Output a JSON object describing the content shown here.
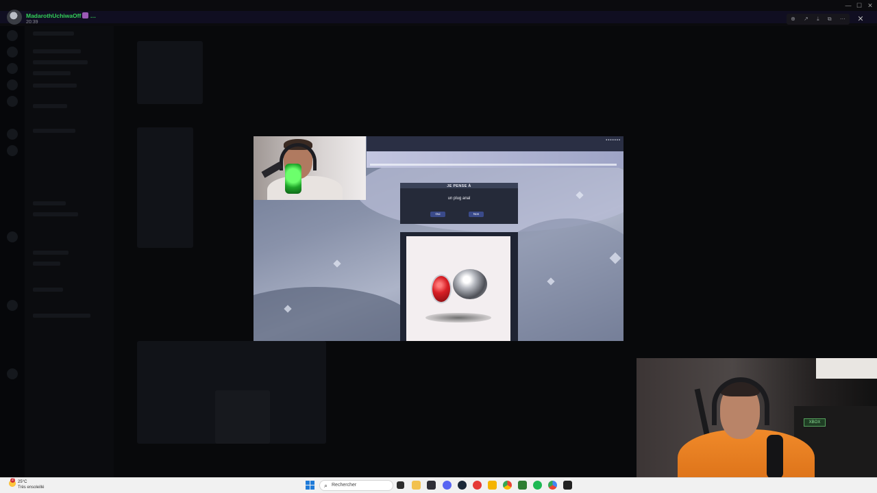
{
  "viewer": {
    "username": "MadarothUchiwaOff",
    "time": "20:39",
    "tools": [
      "zoom-in-icon",
      "share-icon",
      "download-icon",
      "open-external-icon",
      "more-icon"
    ],
    "close_icon": "close-icon"
  },
  "window_controls": [
    "—",
    "☐",
    "✕"
  ],
  "stream": {
    "akinator": {
      "title": "JE PENSE À",
      "answer": "un plug anal",
      "yes_label": "Oui",
      "no_label": "Non"
    }
  },
  "webcam_sign": "XBOX",
  "taskbar": {
    "weather_temp": "25°C",
    "weather_desc": "Très ensoleillé",
    "weather_badge": "2",
    "search_placeholder": "Rechercher",
    "apps": [
      "task-view-icon",
      "file-explorer-icon",
      "terminal-icon",
      "discord-icon",
      "steam-icon",
      "app-red-icon",
      "app-yellow-icon",
      "chrome-icon",
      "app-green-icon",
      "spotify-icon",
      "chrome-alt-icon",
      "app-dark-icon"
    ]
  },
  "colors": {
    "username": "#33d15a",
    "mic_glow": "#6cff6c",
    "shirt": "#f08a2a",
    "start": "#1f7bd8"
  }
}
